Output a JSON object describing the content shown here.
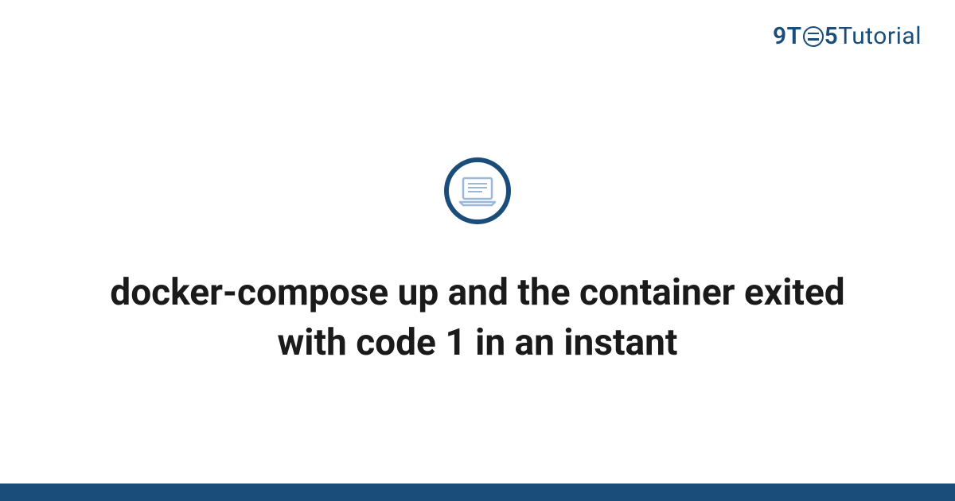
{
  "brand": {
    "nine": "9",
    "t": "T",
    "five": "5",
    "tutorial": "Tutorial"
  },
  "main": {
    "title": "docker-compose up and the container exited with code 1 in an instant"
  },
  "colors": {
    "accent": "#1a4d7a",
    "laptop_outline": "#9bb8d9"
  }
}
